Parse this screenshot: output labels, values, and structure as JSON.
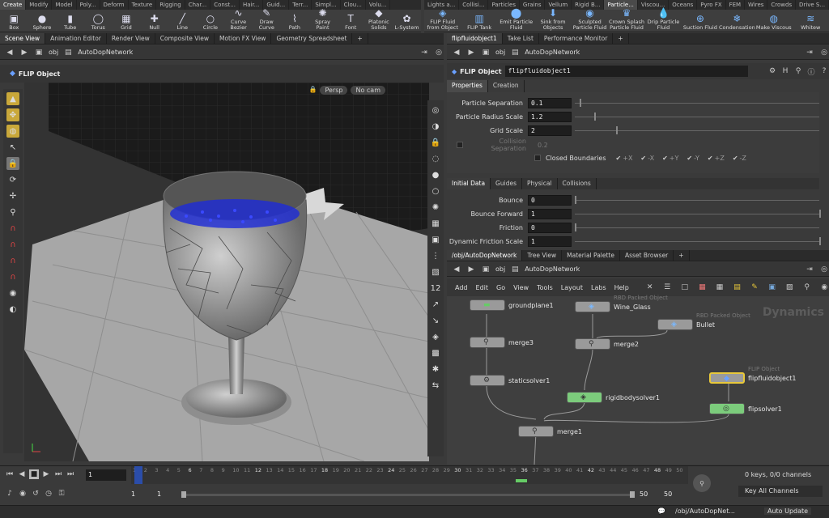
{
  "shelf_tabs_left": [
    "Create",
    "Modify",
    "Model",
    "Poly...",
    "Deform",
    "Texture",
    "Rigging",
    "Char...",
    "Const...",
    "Hair...",
    "Guid...",
    "Terr...",
    "Simpl...",
    "Clou...",
    "Volu..."
  ],
  "shelf_tabs_right": [
    "Lights a...",
    "Collisi...",
    "Particles",
    "Grains",
    "Vellum",
    "Rigid B...",
    "Particle...",
    "Viscou...",
    "Oceans",
    "Pyro FX",
    "FEM",
    "Wires",
    "Crowds",
    "Drive S..."
  ],
  "shelf_tools_left": [
    {
      "label": "Box",
      "icon": "box-icon"
    },
    {
      "label": "Sphere",
      "icon": "sphere-icon"
    },
    {
      "label": "Tube",
      "icon": "tube-icon"
    },
    {
      "label": "Torus",
      "icon": "torus-icon"
    },
    {
      "label": "Grid",
      "icon": "grid-icon"
    },
    {
      "label": "Null",
      "icon": "null-icon"
    },
    {
      "label": "Line",
      "icon": "line-icon"
    },
    {
      "label": "Circle",
      "icon": "circle-icon"
    },
    {
      "label": "Curve Bezier",
      "icon": "curve-bezier-icon"
    },
    {
      "label": "Draw Curve",
      "icon": "draw-curve-icon"
    },
    {
      "label": "Path",
      "icon": "path-icon"
    },
    {
      "label": "Spray Paint",
      "icon": "spray-paint-icon"
    },
    {
      "label": "Font",
      "icon": "font-icon"
    },
    {
      "label": "Platonic Solids",
      "icon": "platonic-icon"
    },
    {
      "label": "L-System",
      "icon": "lsystem-icon"
    }
  ],
  "shelf_tools_right": [
    {
      "label": "FLIP Fluid from Object",
      "icon": "flip-fluid-icon"
    },
    {
      "label": "FLIP Tank",
      "icon": "flip-tank-icon"
    },
    {
      "label": "Emit Particle Fluid",
      "icon": "emit-icon"
    },
    {
      "label": "Sink from Objects",
      "icon": "sink-icon"
    },
    {
      "label": "Sculpted Particle Fluid",
      "icon": "sculpted-icon"
    },
    {
      "label": "Crown Splash Particle Fluid",
      "icon": "crown-icon"
    },
    {
      "label": "Drip Particle Fluid",
      "icon": "drip-icon"
    },
    {
      "label": "Suction Fluid",
      "icon": "suction-icon"
    },
    {
      "label": "Condensation",
      "icon": "condensation-icon"
    },
    {
      "label": "Make Viscous",
      "icon": "viscous-icon"
    },
    {
      "label": "Whitew",
      "icon": "whitewater-icon"
    }
  ],
  "left_pane_tabs": [
    "Scene View",
    "Animation Editor",
    "Render View",
    "Composite View",
    "Motion FX View",
    "Geometry Spreadsheet"
  ],
  "right_top_tabs": [
    "flipfluidobject1",
    "Take List",
    "Performance Monitor"
  ],
  "path": {
    "root": "obj",
    "network": "AutoDopNetwork"
  },
  "viewport": {
    "title": "FLIP Object",
    "camera_persp": "Persp",
    "camera_cam": "No cam"
  },
  "params": {
    "node_type": "FLIP Object",
    "node_name": "flipfluidobject1",
    "tabs": [
      "Properties",
      "Creation"
    ],
    "rows": [
      {
        "label": "Particle Separation",
        "value": "0.1",
        "slider": 0.02
      },
      {
        "label": "Particle Radius Scale",
        "value": "1.2",
        "slider": 0.08
      },
      {
        "label": "Grid Scale",
        "value": "2",
        "slider": 0.17
      }
    ],
    "collision_sep_label": "Collision Separation",
    "collision_sep_value": "0.2",
    "closed_boundaries_label": "Closed Boundaries",
    "boundaries": [
      "+X",
      "-X",
      "+Y",
      "-Y",
      "+Z",
      "-Z"
    ],
    "sub_tabs": [
      "Initial Data",
      "Guides",
      "Physical",
      "Collisions"
    ],
    "sub_rows": [
      {
        "label": "Bounce",
        "value": "0",
        "slider": 0.0
      },
      {
        "label": "Bounce Forward",
        "value": "1",
        "slider": 1.0
      },
      {
        "label": "Friction",
        "value": "0",
        "slider": 0.0
      },
      {
        "label": "Dynamic Friction Scale",
        "value": "1",
        "slider": 1.0
      }
    ]
  },
  "network": {
    "tabs": [
      "/obj/AutoDopNetwork",
      "Tree View",
      "Material Palette",
      "Asset Browser"
    ],
    "menu": [
      "Add",
      "Edit",
      "Go",
      "View",
      "Tools",
      "Layout",
      "Labs",
      "Help"
    ],
    "context_label": "Dynamics",
    "nodes": [
      {
        "name": "groundplane1",
        "sub": ""
      },
      {
        "name": "Wine_Glass",
        "sub": "RBD Packed Object"
      },
      {
        "name": "Bullet",
        "sub": "RBD Packed Object"
      },
      {
        "name": "merge3",
        "sub": ""
      },
      {
        "name": "merge2",
        "sub": ""
      },
      {
        "name": "staticsolver1",
        "sub": ""
      },
      {
        "name": "rigidbodysolver1",
        "sub": ""
      },
      {
        "name": "flipfluidobject1",
        "sub": "FLIP Object"
      },
      {
        "name": "flipsolver1",
        "sub": ""
      },
      {
        "name": "merge1",
        "sub": ""
      }
    ]
  },
  "timeline": {
    "ticks": [
      "1",
      "2",
      "3",
      "4",
      "5",
      "6",
      "7",
      "8",
      "9",
      "10",
      "11",
      "12",
      "13",
      "14",
      "15",
      "16",
      "17",
      "18",
      "19",
      "20",
      "21",
      "22",
      "23",
      "24",
      "25",
      "26",
      "27",
      "28",
      "29",
      "30",
      "31",
      "32",
      "33",
      "34",
      "35",
      "36",
      "37",
      "38",
      "39",
      "40",
      "41",
      "42",
      "43",
      "44",
      "45",
      "46",
      "47",
      "48",
      "49",
      "50"
    ],
    "current_frame": "1",
    "range_start": "1",
    "range_start2": "1",
    "range_end": "50",
    "range_end2": "50",
    "keys_label": "0 keys, 0/0 channels",
    "key_channels": "Key All Channels"
  },
  "status": {
    "path": "/obj/AutoDopNet...",
    "update": "Auto Update"
  }
}
